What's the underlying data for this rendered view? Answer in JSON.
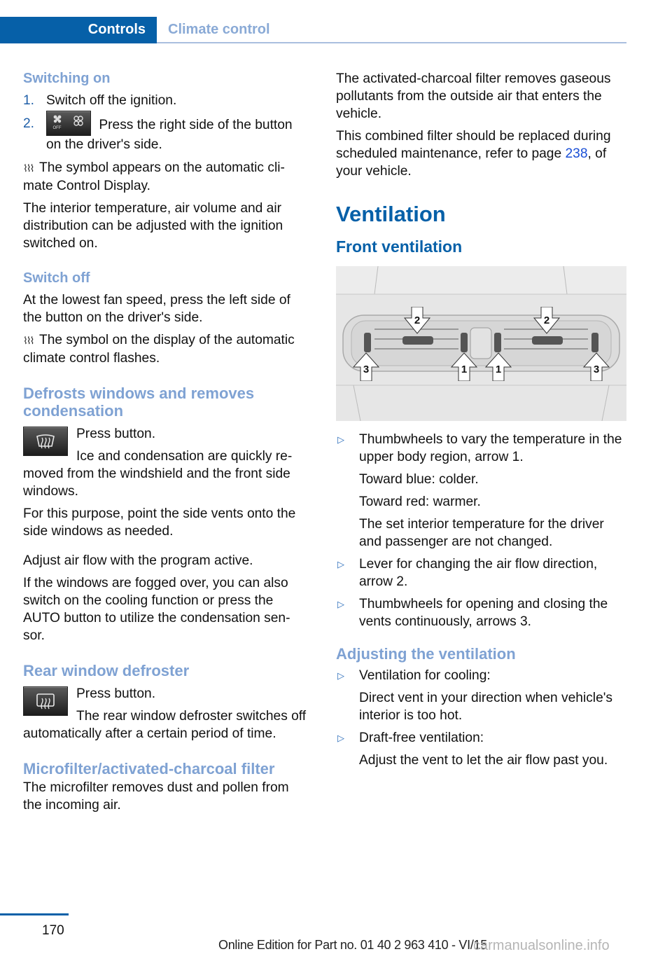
{
  "header": {
    "chapter": "Controls",
    "section": "Climate control"
  },
  "left_column": {
    "switching_on": {
      "heading": "Switching on",
      "steps": [
        {
          "num": "1.",
          "text": "Switch off the ignition."
        },
        {
          "num": "2.",
          "text": "Press the right side of the button on the driver's side.",
          "icon": "fan-off-on-button-icon"
        }
      ],
      "symbol_note": "The symbol appears on the automatic cli-mate Control Display.",
      "para": "The interior temperature, air volume and air distribution can be adjusted with the ignition switched on."
    },
    "switch_off": {
      "heading": "Switch off",
      "para": "At the lowest fan speed, press the left side of the button on the driver's side.",
      "symbol_note": "The symbol on the display of the automatic climate control flashes."
    },
    "defrost": {
      "heading": "Defrosts windows and removes condensation",
      "icon": "windshield-defrost-button-icon",
      "line1": "Press button.",
      "line2": "Ice and condensation are quickly re-moved from the windshield and the front side windows.",
      "para1": "For this purpose, point the side vents onto the side windows as needed.",
      "para2": "Adjust air flow with the program active.",
      "para3": "If the windows are fogged over, you can also switch on the cooling function or press the AUTO button to utilize the condensation sen-sor."
    },
    "rear_defroster": {
      "heading": "Rear window defroster",
      "icon": "rear-window-defrost-button-icon",
      "line1": "Press button.",
      "line2": "The rear window defroster switches off automatically after a certain period of time."
    },
    "microfilter": {
      "heading": "Microfilter/activated-charcoal filter",
      "para": "The microfilter removes dust and pollen from the incoming air."
    }
  },
  "right_column": {
    "charcoal_para": "The activated-charcoal filter removes gaseous pollutants from the outside air that enters the vehicle.",
    "combined_pre": "This combined filter should be replaced during scheduled maintenance, refer to page ",
    "combined_link": "238",
    "combined_post": ", of your vehicle.",
    "ventilation_title": "Ventilation",
    "front_ventilation_title": "Front ventilation",
    "photo": {
      "description": "Dashboard center air vents with numbered arrows",
      "labels": [
        "2",
        "2",
        "3",
        "1",
        "1",
        "3"
      ]
    },
    "bullets": [
      {
        "lines": [
          "Thumbwheels to vary the temperature in the upper body region, arrow 1.",
          "Toward blue: colder.",
          "Toward red: warmer.",
          "The set interior temperature for the driver and passenger are not changed."
        ]
      },
      {
        "lines": [
          "Lever for changing the air flow direction, arrow 2."
        ]
      },
      {
        "lines": [
          "Thumbwheels for opening and closing the vents continuously, arrows 3."
        ]
      }
    ],
    "adjusting_heading": "Adjusting the ventilation",
    "adjusting_bullets": [
      {
        "lines": [
          "Ventilation for cooling:",
          "Direct vent in your direction when vehicle's interior is too hot."
        ]
      },
      {
        "lines": [
          "Draft-free ventilation:",
          "Adjust the vent to let the air flow past you."
        ]
      }
    ]
  },
  "footer": {
    "page_number": "170",
    "edition": "Online Edition for Part no. 01 40 2 963 410 - VI/15",
    "watermark": "carmanualsonline.info"
  }
}
